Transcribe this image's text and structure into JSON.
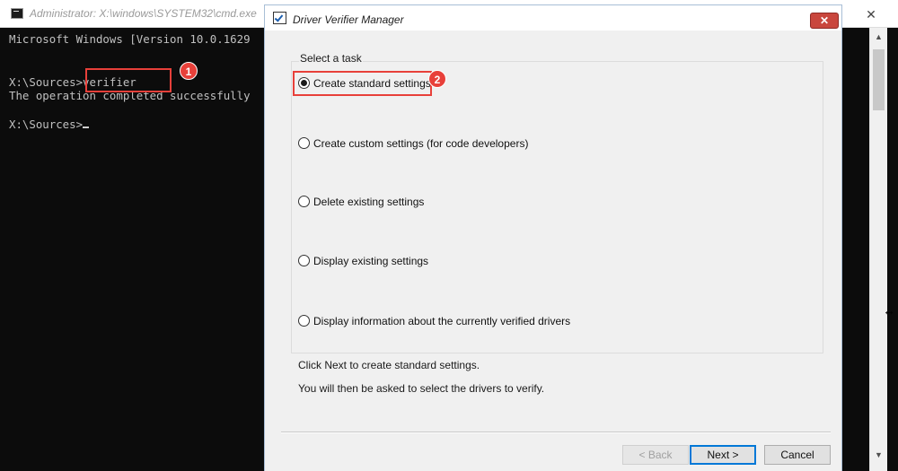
{
  "cmd": {
    "title": "Administrator: X:\\windows\\SYSTEM32\\cmd.exe",
    "close_label": "✕",
    "lines": [
      "Microsoft Windows [Version 10.0.1629",
      "X:\\Sources>verifier",
      "The operation completed successfully",
      "X:\\Sources>"
    ]
  },
  "dialog": {
    "title": "Driver Verifier Manager",
    "close_label": "✕",
    "group_label": "Select a task",
    "options": [
      {
        "label": "Create standard settings",
        "selected": true
      },
      {
        "label": "Create custom settings (for code developers)",
        "selected": false
      },
      {
        "label": "Delete existing settings",
        "selected": false
      },
      {
        "label": "Display existing settings",
        "selected": false
      },
      {
        "label": "Display information about the currently verified drivers",
        "selected": false
      }
    ],
    "info_lines": [
      "Click Next to create standard settings.",
      "You will then be asked to select the drivers to verify."
    ],
    "buttons": {
      "back": "< Back",
      "next": "Next >",
      "cancel": "Cancel"
    }
  },
  "callouts": [
    "1",
    "2"
  ],
  "colors": {
    "console_bg": "#0c0c0c",
    "console_text": "#c0c0c0",
    "callout": "#e8403a",
    "dialog_bg": "#f0f0f0",
    "close_button": "#c9463d"
  },
  "icons": {
    "cmd": "cmd-icon",
    "dialog": "verifier-checkbox-icon",
    "scroll_up": "scroll-up-arrow-icon",
    "scroll_down": "scroll-down-arrow-icon",
    "mouse": "resize-cursor-icon"
  }
}
